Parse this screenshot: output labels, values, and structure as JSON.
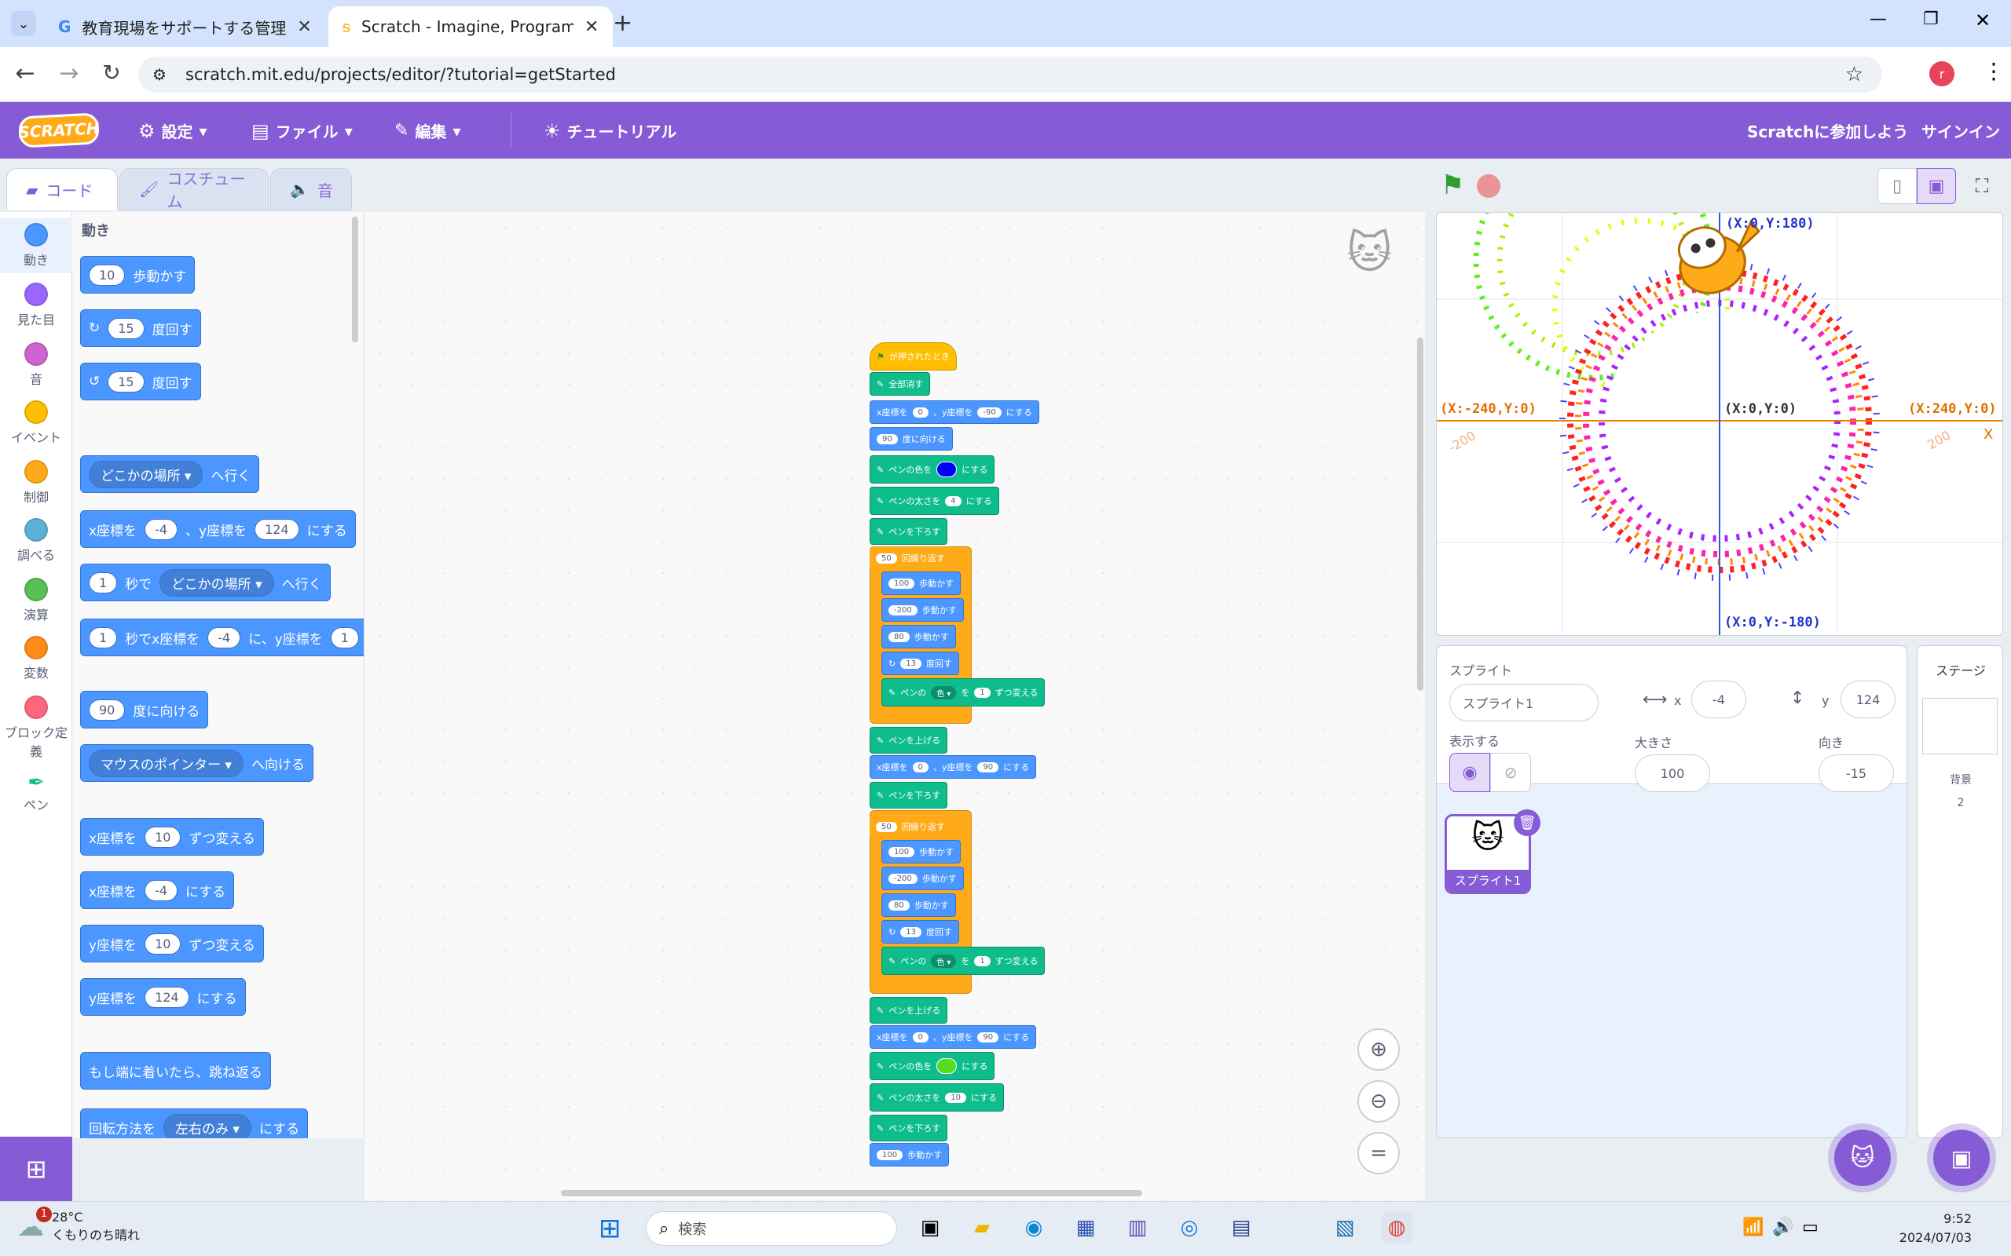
{
  "browser": {
    "tabs": [
      {
        "title": "教育現場をサポートする管理ツール",
        "icon": "google-icon"
      },
      {
        "title": "Scratch - Imagine, Program, Sh",
        "icon": "scratch-icon",
        "active": true
      }
    ],
    "url": "scratch.mit.edu/projects/editor/?tutorial=getStarted",
    "profile_initial": "r"
  },
  "menubar": {
    "logo": "SCRATCH",
    "settings": "設定",
    "file": "ファイル",
    "edit": "編集",
    "tutorial": "チュートリアル",
    "join": "Scratchに参加しよう",
    "signin": "サインイン"
  },
  "editor_tabs": {
    "code": "コード",
    "costume": "コスチューム",
    "sound": "音"
  },
  "categories": [
    {
      "label": "動き",
      "color": "#4c97ff"
    },
    {
      "label": "見た目",
      "color": "#9966ff"
    },
    {
      "label": "音",
      "color": "#cf63cf"
    },
    {
      "label": "イベント",
      "color": "#ffbf00"
    },
    {
      "label": "制御",
      "color": "#ffab19"
    },
    {
      "label": "調べる",
      "color": "#5cb1d6"
    },
    {
      "label": "演算",
      "color": "#59c059"
    },
    {
      "label": "変数",
      "color": "#ff8c1a"
    },
    {
      "label": "ブロック定義",
      "color": "#ff6680"
    },
    {
      "label": "ペン",
      "color": "#0fbd8c"
    }
  ],
  "palette": {
    "heading": "動き",
    "blocks": [
      {
        "pre": "",
        "val": "10",
        "post": "歩動かす"
      },
      {
        "pre": "↻",
        "val": "15",
        "post": "度回す"
      },
      {
        "pre": "↺",
        "val": "15",
        "post": "度回す"
      },
      {
        "pre": "",
        "dd": "どこかの場所",
        "post": "へ行く"
      },
      {
        "pre": "x座標を",
        "val": "-4",
        "mid": "、y座標を",
        "val2": "124",
        "post": "にする"
      },
      {
        "pre": "",
        "val": "1",
        "mid": "秒で",
        "dd": "どこかの場所",
        "post": "へ行く"
      },
      {
        "pre": "",
        "val": "1",
        "mid": "秒でx座標を",
        "val2": "-4",
        "post": "に、y座標を",
        "val3": "1"
      },
      {
        "pre": "",
        "val": "90",
        "post": "度に向ける"
      },
      {
        "pre": "",
        "dd": "マウスのポインター",
        "post": "へ向ける"
      },
      {
        "pre": "x座標を",
        "val": "10",
        "post": "ずつ変える"
      },
      {
        "pre": "x座標を",
        "val": "-4",
        "post": "にする"
      },
      {
        "pre": "y座標を",
        "val": "10",
        "post": "ずつ変える"
      },
      {
        "pre": "y座標を",
        "val": "124",
        "post": "にする"
      },
      {
        "pre": "もし端に着いたら、跳ね返る"
      },
      {
        "pre": "回転方法を",
        "dd": "左右のみ",
        "post": "にする"
      }
    ]
  },
  "script": {
    "hat": "が押されたとき",
    "b1": "全部消す",
    "goto1": {
      "a": "x座標を",
      "x": "0",
      "b": "、y座標を",
      "y": "-90",
      "c": "にする"
    },
    "point": {
      "v": "90",
      "t": "度に向ける"
    },
    "pencolor1": {
      "a": "ペンの色を",
      "b": "にする",
      "swatch": "#0000ff"
    },
    "pensize1": {
      "a": "ペンの太さを",
      "v": "4",
      "b": "にする"
    },
    "pendown": "ペンを下ろす",
    "repeat": {
      "v": "50",
      "t": "回繰り返す"
    },
    "move100": {
      "v": "100",
      "t": "歩動かす"
    },
    "move200": {
      "v": "-200",
      "t": "歩動かす"
    },
    "move80": {
      "v": "80",
      "t": "歩動かす"
    },
    "turn13": {
      "v": "13",
      "t": "度回す"
    },
    "changecolor": {
      "a": "ペンの",
      "dd": "色",
      "b": "を",
      "v": "1",
      "c": "ずつ変える"
    },
    "penup": "ペンを上げる",
    "goto2": {
      "a": "x座標を",
      "x": "0",
      "b": "、y座標を",
      "y": "90",
      "c": "にする"
    },
    "pencolor2": {
      "a": "ペンの色を",
      "b": "にする",
      "swatch": "#55dd22"
    },
    "pensize2": {
      "a": "ペンの太さを",
      "v": "10",
      "b": "にする"
    }
  },
  "stage": {
    "coords": {
      "top": "(X:0,Y:180)",
      "left": "(X:-240,Y:0)",
      "center": "(X:0,Y:0)",
      "right": "(X:240,Y:0)",
      "bottom": "(X:0,Y:-180)",
      "neg200": "-200",
      "pos200": "200",
      "xaxis": "X"
    }
  },
  "sprite_info": {
    "sprite_label": "スプライト",
    "name": "スプライト1",
    "x_label": "x",
    "x": "-4",
    "y_label": "y",
    "y": "124",
    "show_label": "表示する",
    "size_label": "大きさ",
    "size": "100",
    "dir_label": "向き",
    "direction": "-15",
    "thumb_name": "スプライト1"
  },
  "stage_panel": {
    "title": "ステージ",
    "backdrop_label": "背景",
    "backdrop_count": "2"
  },
  "taskbar": {
    "temp": "28°C",
    "weather": "くもりのち晴れ",
    "notif": "1",
    "search": "検索",
    "time": "9:52",
    "date": "2024/07/03"
  }
}
